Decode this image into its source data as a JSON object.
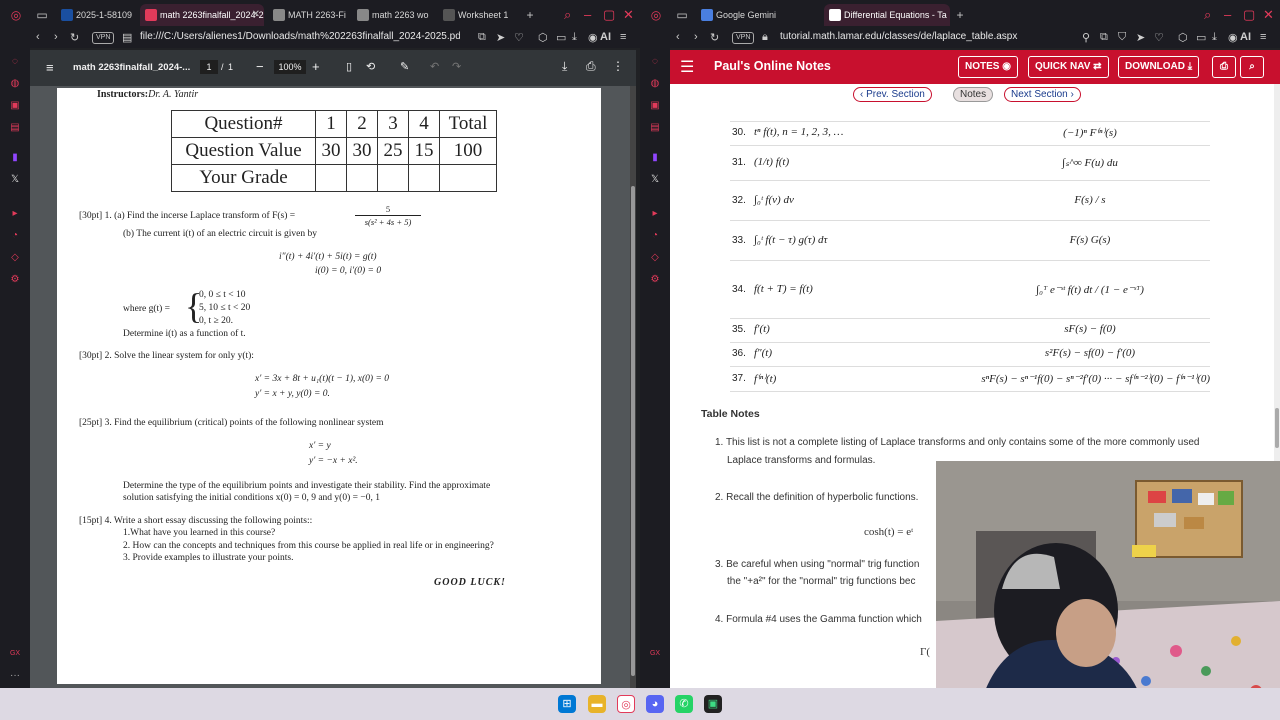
{
  "left_browser": {
    "tabs": [
      {
        "label": "2025-1-58109"
      },
      {
        "label": "math 2263finalfall_2024-2"
      },
      {
        "label": "MATH 2263-Fi"
      },
      {
        "label": "math 2263 wo"
      },
      {
        "label": "Worksheet 1"
      }
    ],
    "vpn_label": "VPN",
    "url": "file:///C:/Users/alienes1/Downloads/math%202263finalfall_2024-2025.pdf",
    "ai_label": "AI"
  },
  "pdf_viewer": {
    "doc_title": "math 2263finalfall_2024-...",
    "page_current": "1",
    "page_sep": "/",
    "page_total": "1",
    "zoom": "100%"
  },
  "exam": {
    "instructors_label": "Instructors:",
    "instructors_name": "Dr. A. Yantir",
    "table": {
      "row1": [
        "Question#",
        "1",
        "2",
        "3",
        "4",
        "Total"
      ],
      "row2": [
        "Question Value",
        "30",
        "30",
        "25",
        "15",
        "100"
      ],
      "row3": [
        "Your Grade",
        "",
        "",
        "",
        "",
        ""
      ]
    },
    "q1_head": "[30pt]  1.   (a)  Find the incerse Laplace transform of F(s) =",
    "q1_frac_num": "5",
    "q1_frac_den": "s(s² + 4s + 5)",
    "q1_b": "(b)  The current i(t) of an electric circuit is given by",
    "q1_eq1": "i″(t) + 4i′(t) + 5i(t) = g(t)",
    "q1_eq2": "i(0) = 0,  i′(0) = 0",
    "q1_where": "where g(t) =",
    "q1_case1": "0,   0 ≤ t < 10",
    "q1_case2": "5,   10 ≤ t < 20",
    "q1_case3": "0,   t ≥ 20.",
    "q1_determine": "Determine i(t) as a function of t.",
    "q2_head": "[30pt]  2.  Solve the linear system for only y(t):",
    "q2_eq1": "x′   =   3x + 8t + u₁(t)(t − 1),   x(0) = 0",
    "q2_eq2": "y′   =   x + y,                        y(0) = 0.",
    "q3_head": "[25pt]  3.  Find the equilibrium (critical) points of the following nonlinear system",
    "q3_eq1": "x′   =   y",
    "q3_eq2": "y′   =   −x + x².",
    "q3_text1": "Determine the type of the equilibrium points and investigate their stability. Find the approximate",
    "q3_text2": "solution satisfying the initial conditions x(0) = 0, 9 and y(0) = −0, 1",
    "q4_head": "[15pt]  4.   Write a short essay discussing the following points::",
    "q4_p1": "1.What have you learned in this course?",
    "q4_p2": "2. How can the concepts and techniques from this course be applied in real life or in engineering?",
    "q4_p3": "3. Provide examples to illustrate your points.",
    "good_luck": "GOOD LUCK!"
  },
  "right_browser": {
    "tabs": [
      {
        "label": "Google Gemini"
      },
      {
        "label": "Differential Equations - Ta"
      }
    ],
    "vpn_label": "VPN",
    "url": "tutorial.math.lamar.edu/classes/de/laplace_table.aspx",
    "ai_label": "AI"
  },
  "pauls": {
    "site_title": "Paul's Online Notes",
    "notes_btn": "NOTES",
    "quicknav_btn": "QUICK NAV",
    "download_btn": "DOWNLOAD",
    "prev_section": "Prev. Section",
    "notes_link": "Notes",
    "next_section": "Next Section",
    "rows": [
      {
        "num": "30.",
        "f": "tⁿ f(t),    n = 1, 2, 3, …",
        "F": "(−1)ⁿ F⁽ⁿ⁾(s)"
      },
      {
        "num": "31.",
        "f": "(1/t) f(t)",
        "F": "∫ₛ^∞ F(u) du"
      },
      {
        "num": "32.",
        "f": "∫₀ᵗ f(v) dv",
        "F": "F(s) / s"
      },
      {
        "num": "33.",
        "f": "∫₀ᵗ f(t − τ) g(τ) dτ",
        "F": "F(s) G(s)"
      },
      {
        "num": "34.",
        "f": "f(t + T) = f(t)",
        "F": "∫₀ᵀ e⁻ˢᵗ f(t) dt / (1 − e⁻ˢᵀ)"
      },
      {
        "num": "35.",
        "f": "f′(t)",
        "F": "sF(s) − f(0)"
      },
      {
        "num": "36.",
        "f": "f″(t)",
        "F": "s²F(s) − sf(0) − f′(0)"
      },
      {
        "num": "37.",
        "f": "f⁽ⁿ⁾(t)",
        "F": "sⁿF(s) − sⁿ⁻¹f(0) − sⁿ⁻²f′(0) ··· − sf⁽ⁿ⁻²⁾(0) − f⁽ⁿ⁻¹⁾(0)"
      }
    ],
    "table_notes_title": "Table Notes",
    "note1_a": "1.  This list is not a complete listing of Laplace transforms and only contains some of the more commonly used",
    "note1_b": "Laplace transforms and formulas.",
    "note2": "2.  Recall the definition of hyperbolic functions.",
    "note2_eq": "cosh(t) = eᵗ",
    "note3_a": "3.  Be careful when using \"normal\" trig function",
    "note3_b": "the \"+a²\" for the \"normal\" trig functions bec",
    "note4": "4.  Formula #4 uses the Gamma function which",
    "note4_eq": "Γ("
  }
}
